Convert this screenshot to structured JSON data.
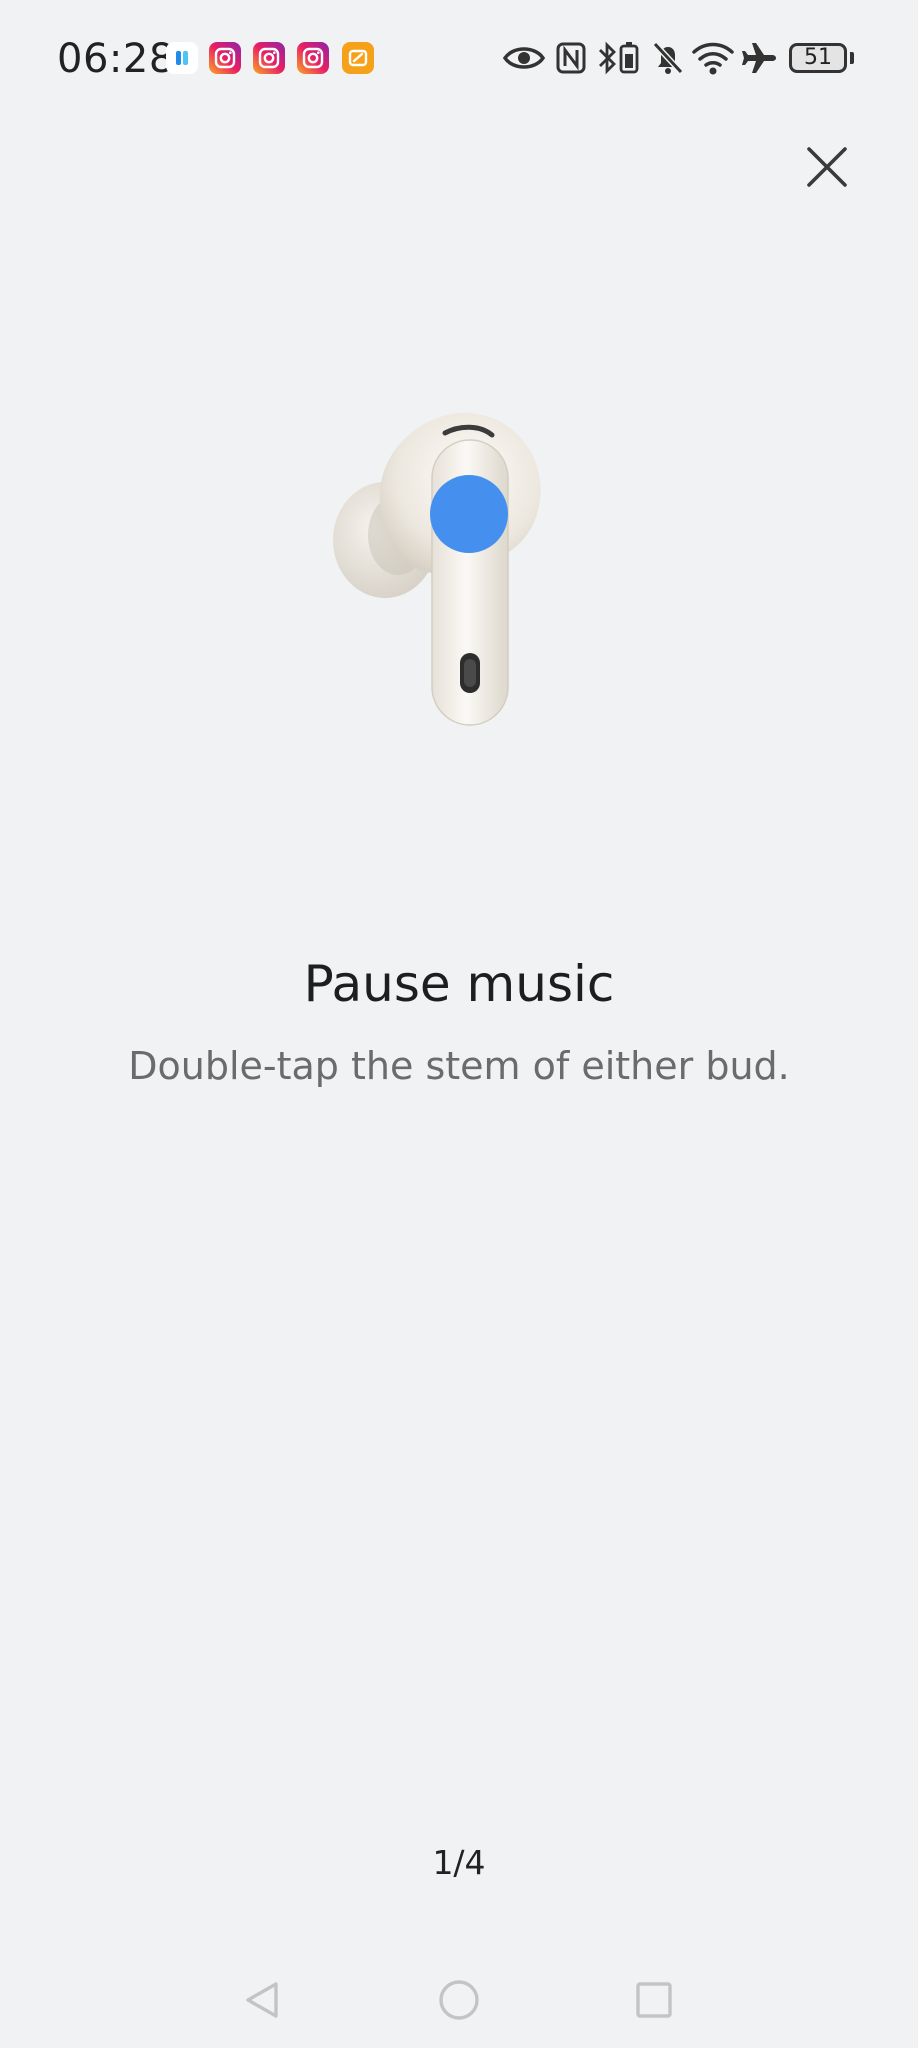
{
  "status_bar": {
    "time": "06:28",
    "battery_level": "51",
    "notification_icons": [
      "app-blue-icon",
      "instagram-icon",
      "instagram-icon",
      "instagram-icon",
      "orange-app-icon"
    ],
    "system_icons": [
      "eye-icon",
      "nfc-icon",
      "bluetooth-battery-icon",
      "mute-icon",
      "wifi-icon",
      "airplane-icon",
      "battery-icon"
    ]
  },
  "onboarding": {
    "title": "Pause music",
    "description": "Double-tap the stem of either bud.",
    "pager": "1/4",
    "accent_color": "#4590ef"
  },
  "nav_bar": {
    "back": "back-icon",
    "home": "home-icon",
    "recents": "recents-icon"
  }
}
